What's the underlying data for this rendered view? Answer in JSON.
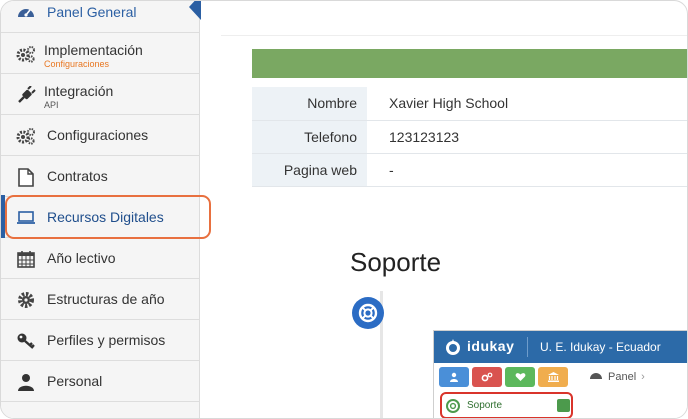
{
  "sidebar": {
    "items": [
      {
        "label": "Panel General",
        "icon": "dashboard-gauge-icon"
      },
      {
        "label": "Implementación",
        "sub": "Configuraciones",
        "icon": "gears-icon"
      },
      {
        "label": "Integración",
        "sub": "API",
        "icon": "plug-icon"
      },
      {
        "label": "Configuraciones",
        "icon": "gears-icon"
      },
      {
        "label": "Contratos",
        "icon": "document-icon"
      },
      {
        "label": "Recursos Digitales",
        "icon": "laptop-icon"
      },
      {
        "label": "Año lectivo",
        "icon": "calendar-icon"
      },
      {
        "label": "Estructuras de año",
        "icon": "gear-icon"
      },
      {
        "label": "Perfiles y permisos",
        "icon": "key-icon"
      },
      {
        "label": "Personal",
        "icon": "user-icon"
      }
    ],
    "active_index": 5
  },
  "school_info": {
    "rows": [
      {
        "key": "Nombre",
        "value": "Xavier High School"
      },
      {
        "key": "Telefono",
        "value": "123123123"
      },
      {
        "key": "Pagina web",
        "value": "-"
      }
    ]
  },
  "support": {
    "title": "Soporte",
    "embed": {
      "brand": "idukay",
      "school": "U. E. Idukay - Ecuador",
      "breadcrumb": "Panel",
      "row_label": "Soporte"
    }
  },
  "colors": {
    "accent_blue": "#2b5fa3",
    "highlight_orange": "#e8703f",
    "header_green": "#7aa862",
    "sub_orange": "#e87722",
    "embed_red": "#d9342b"
  }
}
